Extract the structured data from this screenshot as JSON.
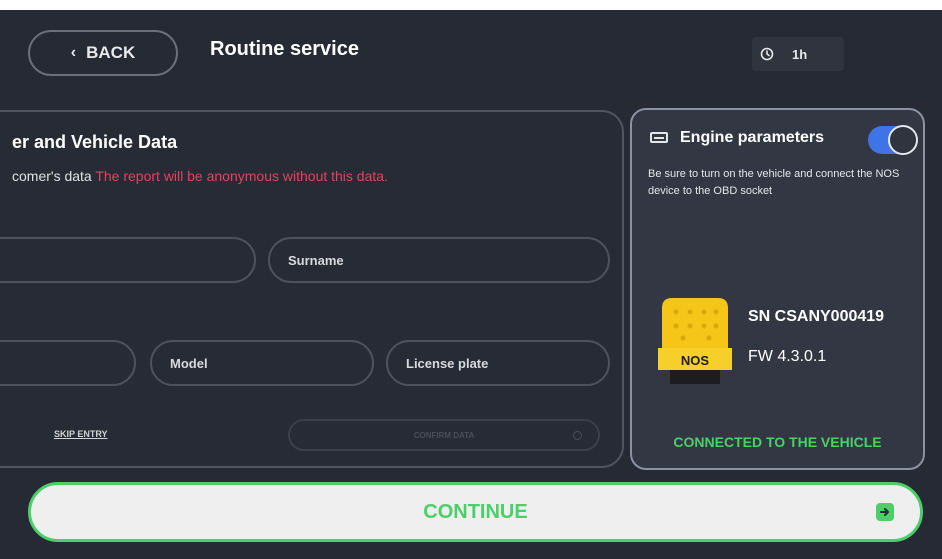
{
  "header": {
    "back_label": "BACK",
    "title": "Routine service",
    "timer": "1h"
  },
  "customer_panel": {
    "title": "er and Vehicle Data",
    "subtitle_lead": "comer's data ",
    "subtitle_warning": "The report will be anonymous without this data.",
    "fields": {
      "surname_placeholder": "Surname",
      "model_placeholder": "Model",
      "license_plate_placeholder": "License plate"
    },
    "skip_label": "SKIP ENTRY",
    "confirm_label": "CONFIRM DATA"
  },
  "engine_panel": {
    "title": "Engine parameters",
    "toggle_on": true,
    "description": "Be sure to turn on the vehicle and connect the NOS device to the OBD socket",
    "device_label": "NOS",
    "serial": "SN CSANY000419",
    "firmware": "FW 4.3.0.1",
    "status": "CONNECTED TO THE VEHICLE"
  },
  "footer": {
    "continue_label": "CONTINUE"
  },
  "colors": {
    "background": "#262a35",
    "accent_green": "#4ccf68",
    "warning_red": "#e0455a",
    "toggle_blue": "#3e74e6",
    "device_yellow": "#f5c518"
  },
  "icons": {
    "back": "chevron-left-icon",
    "timer": "clock-icon",
    "engine": "engine-params-icon",
    "continue": "arrow-right-icon"
  }
}
